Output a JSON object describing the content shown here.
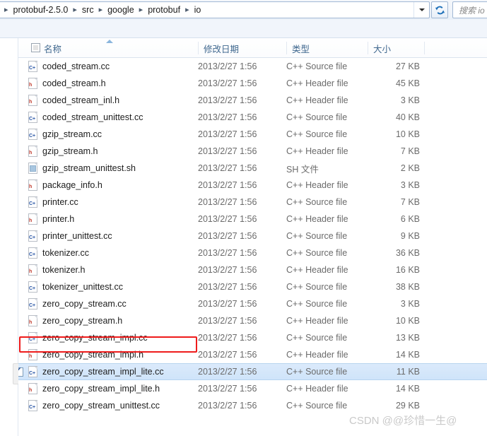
{
  "address_bar": {
    "breadcrumbs": [
      "protobuf-2.5.0",
      "src",
      "google",
      "protobuf",
      "io"
    ],
    "dropdown_icon": "chevron-down-icon",
    "refresh_icon": "refresh-icon"
  },
  "search": {
    "placeholder": "搜索 io"
  },
  "columns": [
    {
      "key": "name",
      "label": "名称"
    },
    {
      "key": "date",
      "label": "修改日期"
    },
    {
      "key": "type",
      "label": "类型"
    },
    {
      "key": "size",
      "label": "大小"
    }
  ],
  "sort": {
    "column": "名称",
    "direction": "ascending",
    "icon": "sort-ascending-icon"
  },
  "files": [
    {
      "name": "coded_stream.cc",
      "date": "2013/2/27 1:56",
      "type": "C++ Source file",
      "size": "27 KB",
      "icon": "cpp-source-icon",
      "selected": false,
      "checked": false
    },
    {
      "name": "coded_stream.h",
      "date": "2013/2/27 1:56",
      "type": "C++ Header file",
      "size": "45 KB",
      "icon": "cpp-header-icon",
      "selected": false,
      "checked": false
    },
    {
      "name": "coded_stream_inl.h",
      "date": "2013/2/27 1:56",
      "type": "C++ Header file",
      "size": "3 KB",
      "icon": "cpp-header-icon",
      "selected": false,
      "checked": false
    },
    {
      "name": "coded_stream_unittest.cc",
      "date": "2013/2/27 1:56",
      "type": "C++ Source file",
      "size": "40 KB",
      "icon": "cpp-source-icon",
      "selected": false,
      "checked": false
    },
    {
      "name": "gzip_stream.cc",
      "date": "2013/2/27 1:56",
      "type": "C++ Source file",
      "size": "10 KB",
      "icon": "cpp-source-icon",
      "selected": false,
      "checked": false
    },
    {
      "name": "gzip_stream.h",
      "date": "2013/2/27 1:56",
      "type": "C++ Header file",
      "size": "7 KB",
      "icon": "cpp-header-icon",
      "selected": false,
      "checked": false
    },
    {
      "name": "gzip_stream_unittest.sh",
      "date": "2013/2/27 1:56",
      "type": "SH 文件",
      "size": "2 KB",
      "icon": "shell-script-icon",
      "selected": false,
      "checked": false
    },
    {
      "name": "package_info.h",
      "date": "2013/2/27 1:56",
      "type": "C++ Header file",
      "size": "3 KB",
      "icon": "cpp-header-icon",
      "selected": false,
      "checked": false
    },
    {
      "name": "printer.cc",
      "date": "2013/2/27 1:56",
      "type": "C++ Source file",
      "size": "7 KB",
      "icon": "cpp-source-icon",
      "selected": false,
      "checked": false
    },
    {
      "name": "printer.h",
      "date": "2013/2/27 1:56",
      "type": "C++ Header file",
      "size": "6 KB",
      "icon": "cpp-header-icon",
      "selected": false,
      "checked": false
    },
    {
      "name": "printer_unittest.cc",
      "date": "2013/2/27 1:56",
      "type": "C++ Source file",
      "size": "9 KB",
      "icon": "cpp-source-icon",
      "selected": false,
      "checked": false
    },
    {
      "name": "tokenizer.cc",
      "date": "2013/2/27 1:56",
      "type": "C++ Source file",
      "size": "36 KB",
      "icon": "cpp-source-icon",
      "selected": false,
      "checked": false
    },
    {
      "name": "tokenizer.h",
      "date": "2013/2/27 1:56",
      "type": "C++ Header file",
      "size": "16 KB",
      "icon": "cpp-header-icon",
      "selected": false,
      "checked": false
    },
    {
      "name": "tokenizer_unittest.cc",
      "date": "2013/2/27 1:56",
      "type": "C++ Source file",
      "size": "38 KB",
      "icon": "cpp-source-icon",
      "selected": false,
      "checked": false
    },
    {
      "name": "zero_copy_stream.cc",
      "date": "2013/2/27 1:56",
      "type": "C++ Source file",
      "size": "3 KB",
      "icon": "cpp-source-icon",
      "selected": false,
      "checked": false
    },
    {
      "name": "zero_copy_stream.h",
      "date": "2013/2/27 1:56",
      "type": "C++ Header file",
      "size": "10 KB",
      "icon": "cpp-header-icon",
      "selected": false,
      "checked": false
    },
    {
      "name": "zero_copy_stream_impl.cc",
      "date": "2013/2/27 1:56",
      "type": "C++ Source file",
      "size": "13 KB",
      "icon": "cpp-source-icon",
      "selected": false,
      "checked": false
    },
    {
      "name": "zero_copy_stream_impl.h",
      "date": "2013/2/27 1:56",
      "type": "C++ Header file",
      "size": "14 KB",
      "icon": "cpp-header-icon",
      "selected": false,
      "checked": false
    },
    {
      "name": "zero_copy_stream_impl_lite.cc",
      "date": "2013/2/27 1:56",
      "type": "C++ Source file",
      "size": "11 KB",
      "icon": "cpp-source-icon",
      "selected": true,
      "checked": true
    },
    {
      "name": "zero_copy_stream_impl_lite.h",
      "date": "2013/2/27 1:56",
      "type": "C++ Header file",
      "size": "14 KB",
      "icon": "cpp-header-icon",
      "selected": false,
      "checked": false
    },
    {
      "name": "zero_copy_stream_unittest.cc",
      "date": "2013/2/27 1:56",
      "type": "C++ Source file",
      "size": "29 KB",
      "icon": "cpp-source-icon",
      "selected": false,
      "checked": false
    }
  ],
  "annotation": {
    "color": "#ee1b1b",
    "target": "zero_copy_stream_impl_lite.cc"
  },
  "watermark": {
    "text": "CSDN @@珍惜一生@"
  },
  "colors": {
    "selection": "#cfe4fa",
    "header_text": "#40688f",
    "annotation_red": "#ee1b1b"
  }
}
